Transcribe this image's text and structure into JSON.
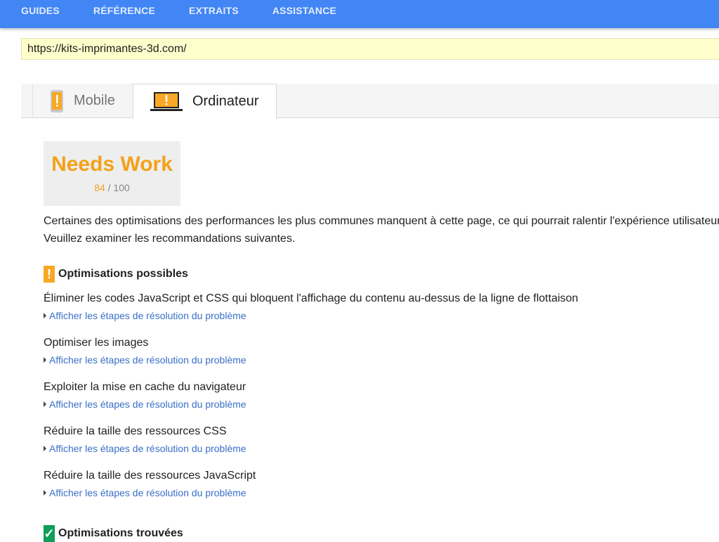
{
  "topnav": {
    "items": [
      "GUIDES",
      "RÉFÉRENCE",
      "EXTRAITS",
      "ASSISTANCE"
    ]
  },
  "url": "https://kits-imprimantes-3d.com/",
  "tabs": {
    "mobile": "Mobile",
    "desktop": "Ordinateur"
  },
  "score": {
    "label": "Needs Work",
    "value": "84",
    "max": "/ 100",
    "color": "#f4a11a"
  },
  "intro": {
    "line1": "Certaines des optimisations des performances les plus communes manquent à cette page, ce qui pourrait ralentir l'expérience utilisateur.",
    "line2": "Veuillez examiner les recommandations suivantes."
  },
  "possible": {
    "badge": "!",
    "title": "Optimisations possibles",
    "rules": [
      {
        "title": "Éliminer les codes JavaScript et CSS qui bloquent l'affichage du contenu au-dessus de la ligne de flottaison",
        "link": "Afficher les étapes de résolution du problème"
      },
      {
        "title": "Optimiser les images",
        "link": "Afficher les étapes de résolution du problème"
      },
      {
        "title": "Exploiter la mise en cache du navigateur",
        "link": "Afficher les étapes de résolution du problème"
      },
      {
        "title": "Réduire la taille des ressources CSS",
        "link": "Afficher les étapes de résolution du problème"
      },
      {
        "title": "Réduire la taille des ressources JavaScript",
        "link": "Afficher les étapes de résolution du problème"
      }
    ]
  },
  "found": {
    "badge": "✓",
    "title": "Optimisations trouvées"
  }
}
